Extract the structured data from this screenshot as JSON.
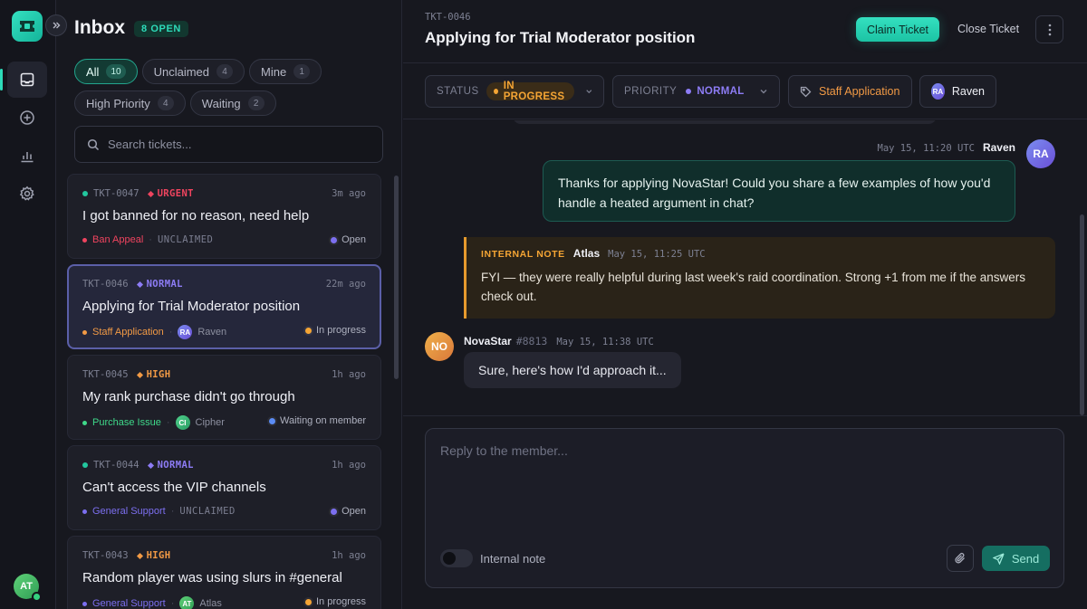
{
  "rail": {
    "nav": [
      {
        "icon": "inbox-icon",
        "active": true
      },
      {
        "icon": "plus-circle-icon",
        "active": false
      },
      {
        "icon": "bar-chart-icon",
        "active": false
      },
      {
        "icon": "gear-icon",
        "active": false
      }
    ],
    "user_initials": "AT"
  },
  "inbox": {
    "title": "Inbox",
    "open_badge": "8 OPEN",
    "filters": [
      {
        "label": "All",
        "count": "10",
        "active": true
      },
      {
        "label": "Unclaimed",
        "count": "4",
        "active": false
      },
      {
        "label": "Mine",
        "count": "1",
        "active": false
      },
      {
        "label": "High Priority",
        "count": "4",
        "active": false
      },
      {
        "label": "Waiting",
        "count": "2",
        "active": false
      }
    ],
    "search_placeholder": "Search tickets...",
    "tickets": [
      {
        "id": "TKT-0047",
        "priority": "URGENT",
        "time": "3m ago",
        "title": "I got banned for no reason, need help",
        "category": "Ban Appeal",
        "assignee": "UNCLAIMED",
        "status": "Open",
        "new": true
      },
      {
        "id": "TKT-0046",
        "priority": "NORMAL",
        "time": "22m ago",
        "title": "Applying for Trial Moderator position",
        "category": "Staff Application",
        "assignee_initials": "RA",
        "assignee": "Raven",
        "status": "In progress",
        "new": false
      },
      {
        "id": "TKT-0045",
        "priority": "HIGH",
        "time": "1h ago",
        "title": "My rank purchase didn't go through",
        "category": "Purchase Issue",
        "assignee_initials": "CI",
        "assignee": "Cipher",
        "status": "Waiting on member",
        "new": false
      },
      {
        "id": "TKT-0044",
        "priority": "NORMAL",
        "time": "1h ago",
        "title": "Can't access the VIP channels",
        "category": "General Support",
        "assignee": "UNCLAIMED",
        "status": "Open",
        "new": true
      },
      {
        "id": "TKT-0043",
        "priority": "HIGH",
        "time": "1h ago",
        "title": "Random player was using slurs in #general",
        "category": "General Support",
        "assignee_initials": "AT",
        "assignee": "Atlas",
        "status": "In progress",
        "new": false
      }
    ]
  },
  "ticket": {
    "id": "TKT-0046",
    "title": "Applying for Trial Moderator position",
    "claim_label": "Claim Ticket",
    "close_label": "Close Ticket",
    "status_key": "STATUS",
    "status_value": "IN PROGRESS",
    "priority_key": "PRIORITY",
    "priority_value": "NORMAL",
    "category": "Staff Application",
    "assignee_initials": "RA",
    "assignee": "Raven"
  },
  "messages": {
    "staff": {
      "time": "May 15, 11:20 UTC",
      "author": "Raven",
      "initials": "RA",
      "text": "Thanks for applying NovaStar! Could you share a few examples of how you'd handle a heated argument in chat?"
    },
    "note": {
      "label": "INTERNAL NOTE",
      "author": "Atlas",
      "time": "May 15, 11:25 UTC",
      "text": "FYI — they were really helpful during last week's raid coordination. Strong +1 from me if the answers check out."
    },
    "member": {
      "author": "NovaStar",
      "tag": "#8813",
      "time": "May 15, 11:38 UTC",
      "initials": "NO",
      "text": "Sure, here's how I'd approach it..."
    }
  },
  "composer": {
    "placeholder": "Reply to the member...",
    "toggle_label": "Internal note",
    "send_label": "Send"
  },
  "colors": {
    "accent": "#2ddbb9",
    "urgent": "#f0445f",
    "high": "#f29a45",
    "normal": "#8d7cf5",
    "in_progress": "#f5a534",
    "open": "#7c6ff0",
    "waiting": "#5b8cf5"
  }
}
